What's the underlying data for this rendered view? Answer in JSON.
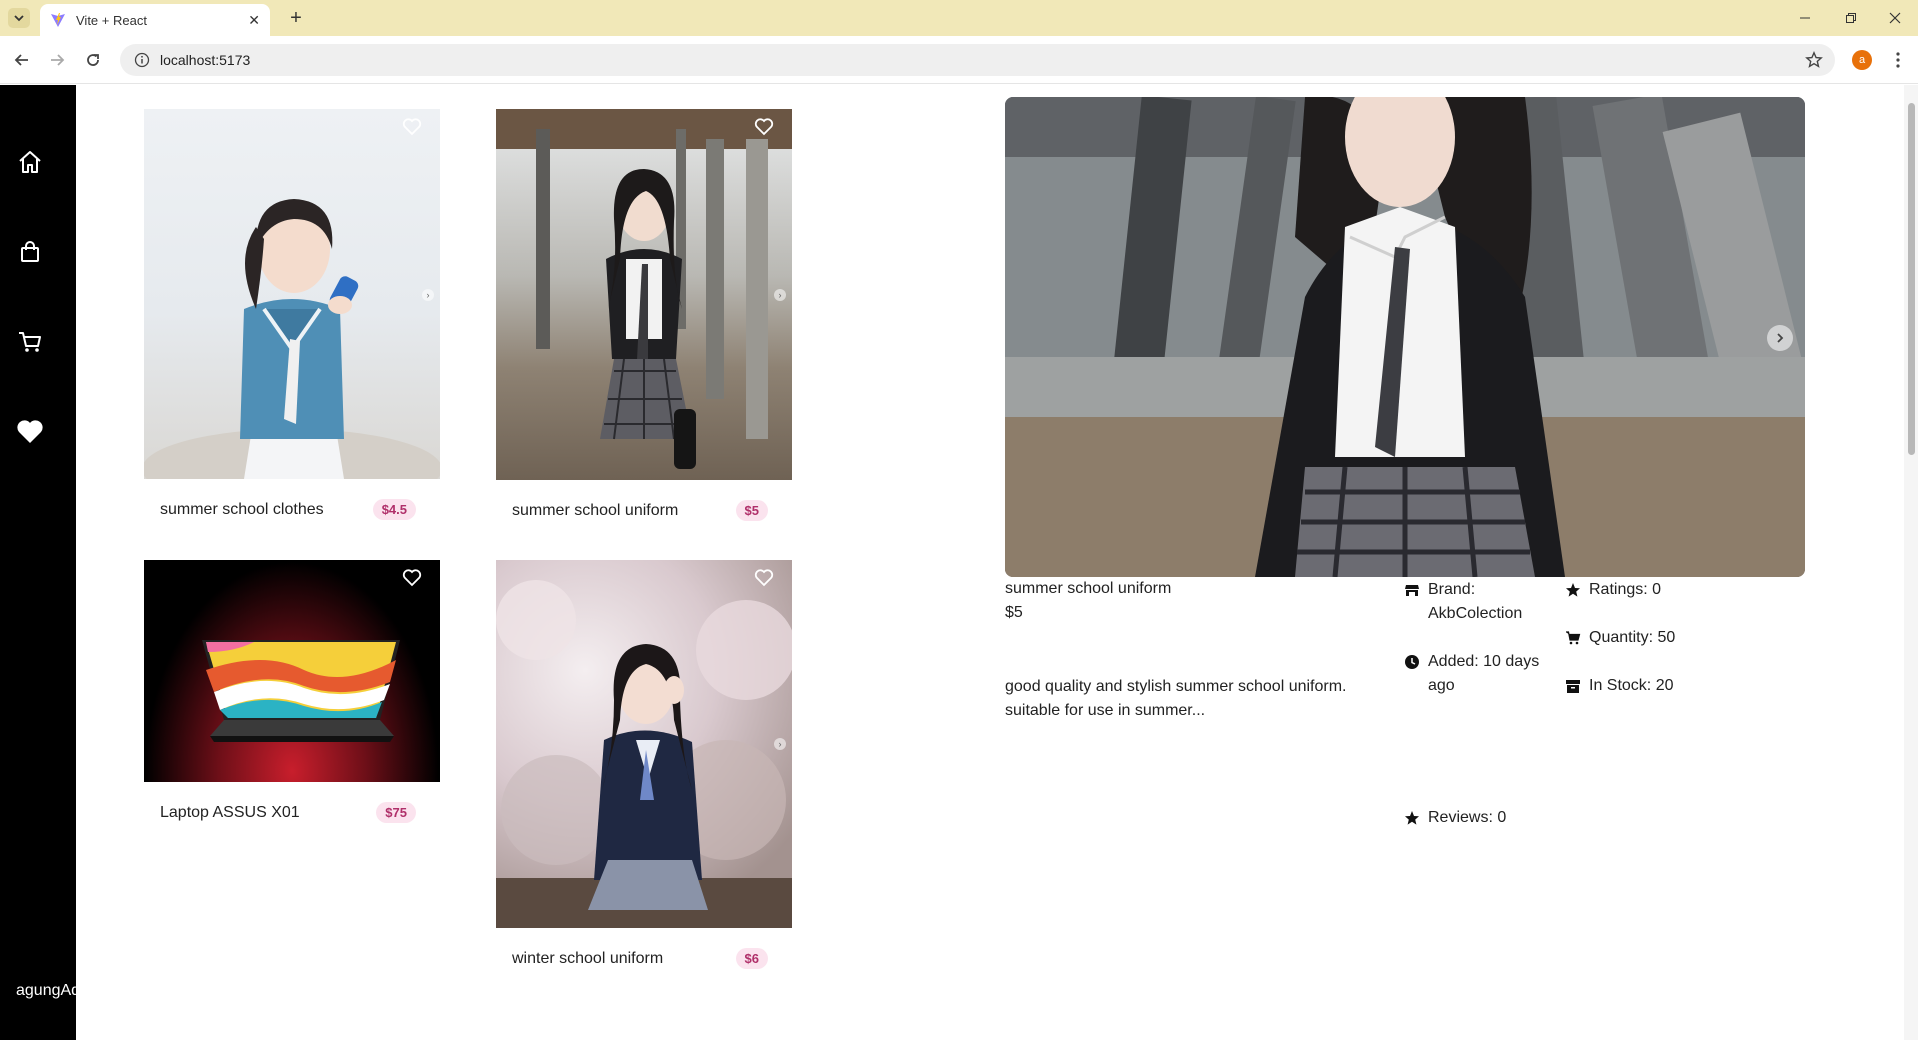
{
  "browser": {
    "tab_title": "Vite + React",
    "url": "localhost:5173",
    "profile_initial": "a"
  },
  "sidebar": {
    "items": [
      "home-icon",
      "shopping-bag-icon",
      "cart-icon",
      "heart-icon"
    ],
    "username": "agungAd"
  },
  "products": [
    {
      "name": "summer school clothes",
      "price": "$4.5"
    },
    {
      "name": "summer school uniform",
      "price": "$5"
    },
    {
      "name": "Laptop ASSUS X01",
      "price": "$75"
    },
    {
      "name": "winter school uniform",
      "price": "$6"
    }
  ],
  "detail": {
    "title": "summer school uniform",
    "price": "$5",
    "description": "good quality and stylish summer school uniform. suitable for use in summer...",
    "brand": "Brand: AkbColection",
    "added": "Added: 10 days ago",
    "reviews": "Reviews: 0",
    "ratings": "Ratings: 0",
    "quantity": "Quantity: 50",
    "in_stock": "In Stock: 20"
  },
  "colors": {
    "sidebar_bg": "#000000",
    "price_text": "#b0306a",
    "price_bg": "#fbe3ee",
    "tabbar_bg": "#f1e8b8"
  }
}
